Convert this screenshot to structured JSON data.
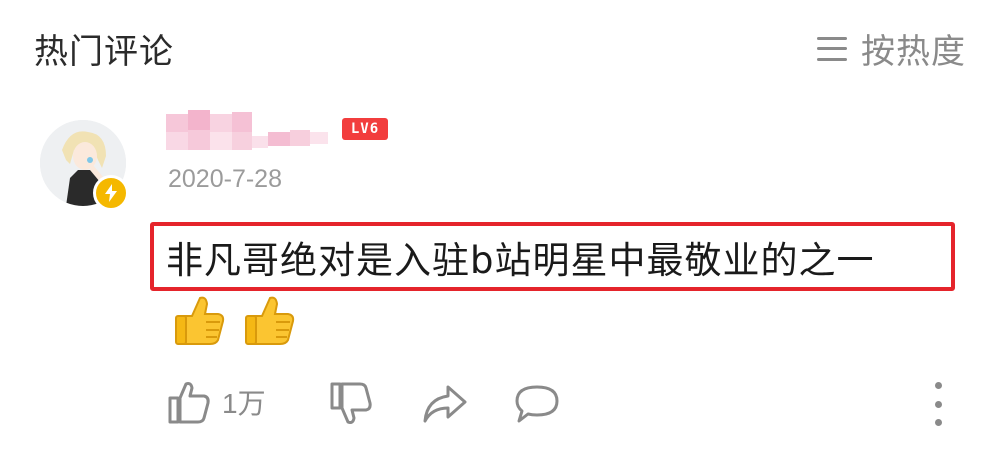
{
  "header": {
    "title": "热门评论",
    "sort_label": "按热度",
    "sort_icon": "menu-icon"
  },
  "comment": {
    "author_level": "LV6",
    "date": "2020-7-28",
    "text": "非凡哥绝对是入驻b站明星中最敬业的之一",
    "emoji": [
      "thumbs-up",
      "thumbs-up"
    ],
    "highlight_color": "#e5242b",
    "level_color": "#f23d3d",
    "badge_color": "#f5b800"
  },
  "actions": {
    "like_count": "1万",
    "icons": [
      "thumbs-up-icon",
      "thumbs-down-icon",
      "share-icon",
      "comment-icon",
      "more-icon"
    ]
  }
}
